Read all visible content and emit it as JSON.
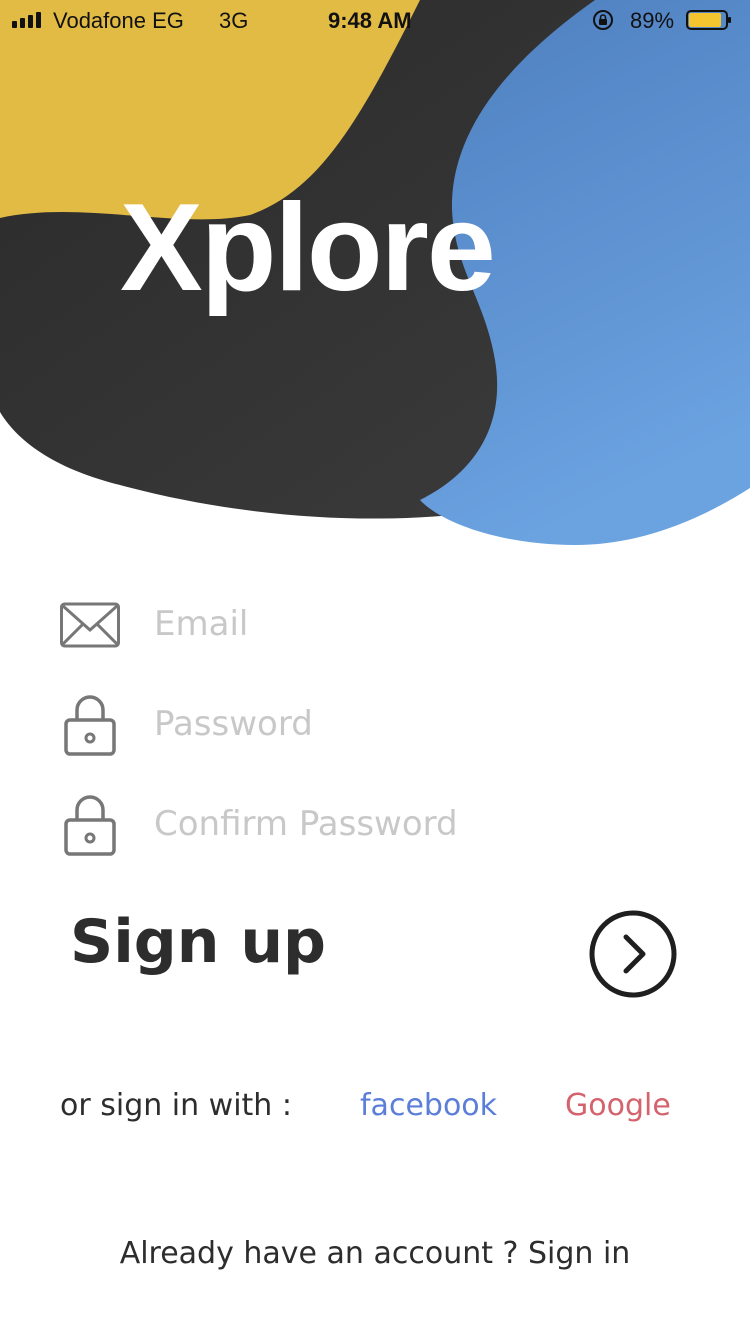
{
  "status_bar": {
    "carrier": "Vodafone EG",
    "network": "3G",
    "time": "9:48 AM",
    "battery_percent": "89%",
    "battery_level": 0.89,
    "icons": [
      "signal-bars-icon",
      "rotation-lock-icon",
      "battery-icon"
    ]
  },
  "brand": {
    "logo_text": "Xplore",
    "colors": {
      "yellow": "#E2BB45",
      "dark": "#333333",
      "blue": "#5B8FD0"
    }
  },
  "form": {
    "email": {
      "placeholder": "Email",
      "value": "",
      "icon": "mail-icon"
    },
    "password": {
      "placeholder": "Password",
      "value": "",
      "icon": "lock-icon"
    },
    "confirm_password": {
      "placeholder": "Confirm Password",
      "value": "",
      "icon": "lock-icon"
    }
  },
  "signup": {
    "title": "Sign up",
    "button_icon": "chevron-right-circle-icon"
  },
  "social": {
    "label": "or sign in with :",
    "facebook": "facebook",
    "google": "Google",
    "facebook_color": "#5B7FD8",
    "google_color": "#D4636E"
  },
  "footer": {
    "signin_text": "Already have an account ? Sign in"
  }
}
